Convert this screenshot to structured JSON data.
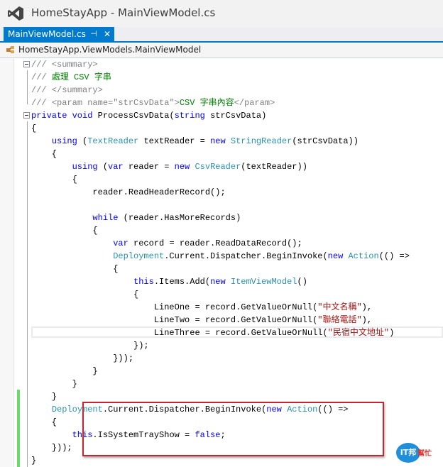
{
  "window": {
    "title": "HomeStayApp - MainViewModel.cs",
    "logo_icon": "visual-studio-logo-icon"
  },
  "tabs": [
    {
      "label": "MainViewModel.cs",
      "pin": "⊣",
      "close": "✕",
      "active": true
    }
  ],
  "navigation": {
    "type_icon": "class-icon",
    "class_path": "HomeStayApp.ViewModels.MainViewModel"
  },
  "colors": {
    "accent": "#007acc",
    "keyword": "#0000ff",
    "type": "#2b91af",
    "string": "#a31515",
    "comment_green": "#008000",
    "comment_gray": "#808080",
    "highlight_box": "#c4252f"
  },
  "code": {
    "lines": [
      [
        {
          "t": "/// ",
          "c": "cm"
        },
        {
          "t": "<summary>",
          "c": "cm"
        }
      ],
      [
        {
          "t": "/// ",
          "c": "cm"
        },
        {
          "t": "處理 CSV 字串",
          "c": "cg"
        }
      ],
      [
        {
          "t": "/// ",
          "c": "cm"
        },
        {
          "t": "</summary>",
          "c": "cm"
        }
      ],
      [
        {
          "t": "/// ",
          "c": "cm"
        },
        {
          "t": "<param name=\"strCsvData\">",
          "c": "cm"
        },
        {
          "t": "CSV 字串內容",
          "c": "cg"
        },
        {
          "t": "</param>",
          "c": "cm"
        }
      ],
      [
        {
          "t": "private ",
          "c": "kw"
        },
        {
          "t": "void ",
          "c": "kw"
        },
        {
          "t": "ProcessCsvData(",
          "c": ""
        },
        {
          "t": "string ",
          "c": "kw"
        },
        {
          "t": "strCsvData)",
          "c": ""
        }
      ],
      [
        {
          "t": "{",
          "c": ""
        }
      ],
      [
        {
          "t": "    ",
          "c": ""
        },
        {
          "t": "using ",
          "c": "kw"
        },
        {
          "t": "(",
          "c": ""
        },
        {
          "t": "TextReader ",
          "c": "ty"
        },
        {
          "t": "textReader = ",
          "c": ""
        },
        {
          "t": "new ",
          "c": "kw"
        },
        {
          "t": "StringReader",
          "c": "ty"
        },
        {
          "t": "(strCsvData))",
          "c": ""
        }
      ],
      [
        {
          "t": "    {",
          "c": ""
        }
      ],
      [
        {
          "t": "        ",
          "c": ""
        },
        {
          "t": "using ",
          "c": "kw"
        },
        {
          "t": "(",
          "c": ""
        },
        {
          "t": "var ",
          "c": "kw"
        },
        {
          "t": "reader = ",
          "c": ""
        },
        {
          "t": "new ",
          "c": "kw"
        },
        {
          "t": "CsvReader",
          "c": "ty"
        },
        {
          "t": "(textReader))",
          "c": ""
        }
      ],
      [
        {
          "t": "        {",
          "c": ""
        }
      ],
      [
        {
          "t": "            reader.ReadHeaderRecord();",
          "c": ""
        }
      ],
      [
        {
          "t": "",
          "c": ""
        }
      ],
      [
        {
          "t": "            ",
          "c": ""
        },
        {
          "t": "while ",
          "c": "kw"
        },
        {
          "t": "(reader.HasMoreRecords)",
          "c": ""
        }
      ],
      [
        {
          "t": "            {",
          "c": ""
        }
      ],
      [
        {
          "t": "                ",
          "c": ""
        },
        {
          "t": "var ",
          "c": "kw"
        },
        {
          "t": "record = reader.ReadDataRecord();",
          "c": ""
        }
      ],
      [
        {
          "t": "                ",
          "c": ""
        },
        {
          "t": "Deployment",
          "c": "ty"
        },
        {
          "t": ".Current.Dispatcher.BeginInvoke(",
          "c": ""
        },
        {
          "t": "new ",
          "c": "kw"
        },
        {
          "t": "Action",
          "c": "ty"
        },
        {
          "t": "(() =>",
          "c": ""
        }
      ],
      [
        {
          "t": "                {",
          "c": ""
        }
      ],
      [
        {
          "t": "                    ",
          "c": ""
        },
        {
          "t": "this",
          "c": "kw"
        },
        {
          "t": ".Items.Add(",
          "c": ""
        },
        {
          "t": "new ",
          "c": "kw"
        },
        {
          "t": "ItemViewModel",
          "c": "ty"
        },
        {
          "t": "()",
          "c": ""
        }
      ],
      [
        {
          "t": "                    {",
          "c": ""
        }
      ],
      [
        {
          "t": "                        LineOne = record.GetValueOrNull(",
          "c": ""
        },
        {
          "t": "\"中文名稱\"",
          "c": "st"
        },
        {
          "t": "),",
          "c": ""
        }
      ],
      [
        {
          "t": "                        LineTwo = record.GetValueOrNull(",
          "c": ""
        },
        {
          "t": "\"聯絡電話\"",
          "c": "st"
        },
        {
          "t": "),",
          "c": ""
        }
      ],
      [
        {
          "t": "                        LineThree = record.GetValueOrNull(",
          "c": ""
        },
        {
          "t": "\"民宿中文地址\"",
          "c": "st"
        },
        {
          "t": ")",
          "c": ""
        }
      ],
      [
        {
          "t": "                    });",
          "c": ""
        }
      ],
      [
        {
          "t": "                }));",
          "c": ""
        }
      ],
      [
        {
          "t": "            }",
          "c": ""
        }
      ],
      [
        {
          "t": "        }",
          "c": ""
        }
      ],
      [
        {
          "t": "    }",
          "c": ""
        }
      ],
      [
        {
          "t": "    ",
          "c": ""
        },
        {
          "t": "Deployment",
          "c": "ty"
        },
        {
          "t": ".Current.Dispatcher.BeginInvoke(",
          "c": ""
        },
        {
          "t": "new ",
          "c": "kw"
        },
        {
          "t": "Action",
          "c": "ty"
        },
        {
          "t": "(() =>",
          "c": ""
        }
      ],
      [
        {
          "t": "    {",
          "c": ""
        }
      ],
      [
        {
          "t": "        ",
          "c": ""
        },
        {
          "t": "this",
          "c": "kw"
        },
        {
          "t": ".IsSystemTrayShow = ",
          "c": ""
        },
        {
          "t": "false",
          "c": "kw"
        },
        {
          "t": ";",
          "c": ""
        }
      ],
      [
        {
          "t": "    }));",
          "c": ""
        }
      ],
      [
        {
          "t": "}",
          "c": ""
        }
      ]
    ]
  },
  "watermark": {
    "logo_text": "IT邦",
    "suffix": "幫忙"
  }
}
